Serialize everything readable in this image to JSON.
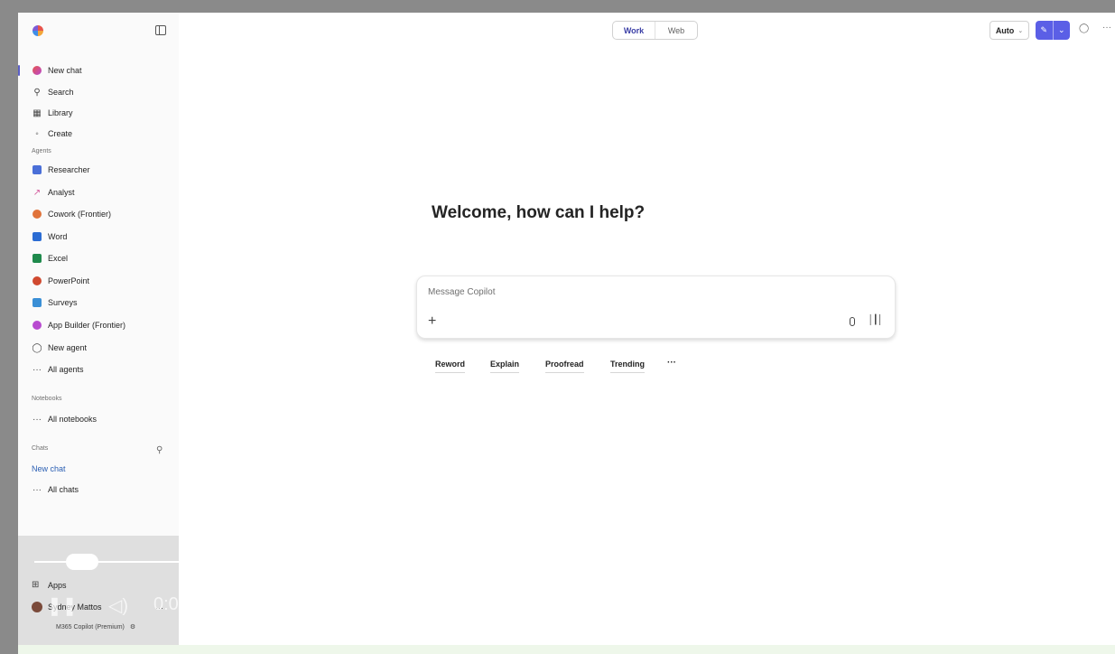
{
  "sidebar": {
    "nav": [
      {
        "label": "New chat",
        "icon": "copilot-color-icon"
      },
      {
        "label": "Search",
        "icon": "search-icon"
      },
      {
        "label": "Library",
        "icon": "library-icon"
      },
      {
        "label": "Create",
        "icon": "create-icon"
      }
    ],
    "agents_header": "Agents",
    "agents": [
      {
        "label": "Researcher",
        "color": "#4a6fd8"
      },
      {
        "label": "Analyst",
        "color": "#d35a9c"
      },
      {
        "label": "Cowork (Frontier)",
        "color": "#e0733a"
      },
      {
        "label": "Word",
        "color": "#2b6cd3"
      },
      {
        "label": "Excel",
        "color": "#1f8a4c"
      },
      {
        "label": "PowerPoint",
        "color": "#d0492f"
      },
      {
        "label": "Surveys",
        "color": "#3a8fd6"
      },
      {
        "label": "App Builder (Frontier)",
        "color": "#b84ad0"
      },
      {
        "label": "New agent",
        "color": "#555555"
      },
      {
        "label": "All agents",
        "color": ""
      }
    ],
    "notebooks_header": "Notebooks",
    "all_notebooks": "All notebooks",
    "chats_header": "Chats",
    "new_chat_link": "New chat",
    "all_chats": "All chats",
    "apps": "Apps",
    "user_name": "Sydney Mattos",
    "plan": "M365 Copilot (Premium)",
    "more": "···"
  },
  "media": {
    "time": "0:0"
  },
  "topbar": {
    "mode_work": "Work",
    "mode_web": "Web",
    "auto_label": "Auto",
    "more": "···"
  },
  "main": {
    "welcome": "Welcome, how can I help?",
    "composer_placeholder": "Message Copilot",
    "suggestions": [
      "Reword",
      "Explain",
      "Proofread",
      "Trending"
    ],
    "suggestions_more": "···"
  },
  "colors": {
    "accent": "#5b5fe6",
    "active": "#5b5fc7"
  }
}
